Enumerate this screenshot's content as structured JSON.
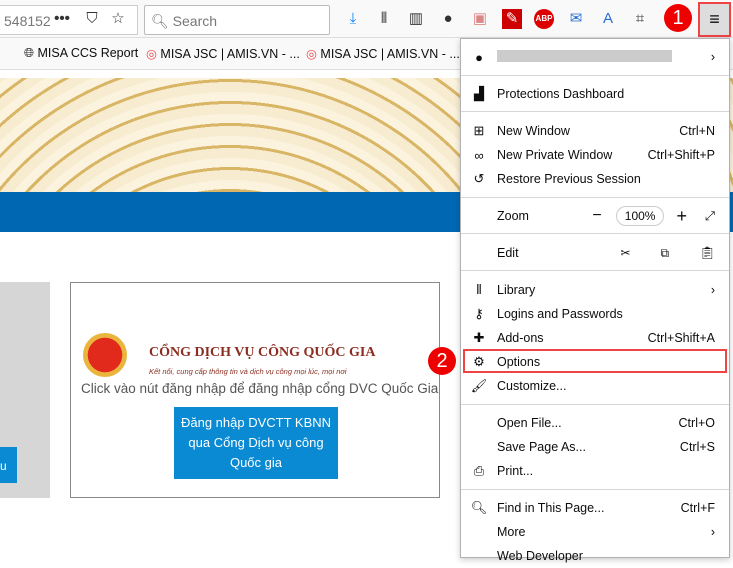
{
  "toolbar": {
    "url_fragment": "548152",
    "search_placeholder": "Search",
    "icons": [
      "ellipsis-icon",
      "pocket-icon",
      "star-icon",
      "download-icon",
      "library-icon",
      "sidebar-icon",
      "account-icon",
      "extension-icon",
      "extension-wand-icon",
      "adblock-icon",
      "mail-icon",
      "translate-icon",
      "extension-grid-icon"
    ],
    "adblock_label": "ABP",
    "menu_icon": "≡"
  },
  "bookmarks": [
    {
      "label": "MISA CCS Report"
    },
    {
      "label": "MISA JSC | AMIS.VN - ..."
    },
    {
      "label": "MISA JSC | AMIS.VN - ..."
    }
  ],
  "page": {
    "portal_title": "CỔNG DỊCH VỤ CÔNG QUỐC GIA",
    "portal_tagline": "Kết nối, cung cấp thông tin và dịch vụ công mọi lúc, mọi nơi",
    "login_hint": "Click vào nút đăng nhập để đăng nhập cổng DVC Quốc Gia",
    "login_button": "Đăng nhập DVCTT KBNN qua Cổng Dịch vụ công Quốc gia",
    "left_button_fragment": "u"
  },
  "annotations": {
    "step1": "1",
    "step2": "2"
  },
  "menu": {
    "protections": "Protections Dashboard",
    "new_window": {
      "label": "New Window",
      "shortcut": "Ctrl+N"
    },
    "private_window": {
      "label": "New Private Window",
      "shortcut": "Ctrl+Shift+P"
    },
    "restore": "Restore Previous Session",
    "zoom": {
      "label": "Zoom",
      "value": "100%",
      "minus": "−",
      "plus": "+"
    },
    "edit": "Edit",
    "library": "Library",
    "logins": "Logins and Passwords",
    "addons": {
      "label": "Add-ons",
      "shortcut": "Ctrl+Shift+A"
    },
    "options": "Options",
    "customize": "Customize...",
    "open_file": {
      "label": "Open File...",
      "shortcut": "Ctrl+O"
    },
    "save_page": {
      "label": "Save Page As...",
      "shortcut": "Ctrl+S"
    },
    "print": "Print...",
    "find": {
      "label": "Find in This Page...",
      "shortcut": "Ctrl+F"
    },
    "more": "More",
    "web_developer": "Web Developer"
  }
}
